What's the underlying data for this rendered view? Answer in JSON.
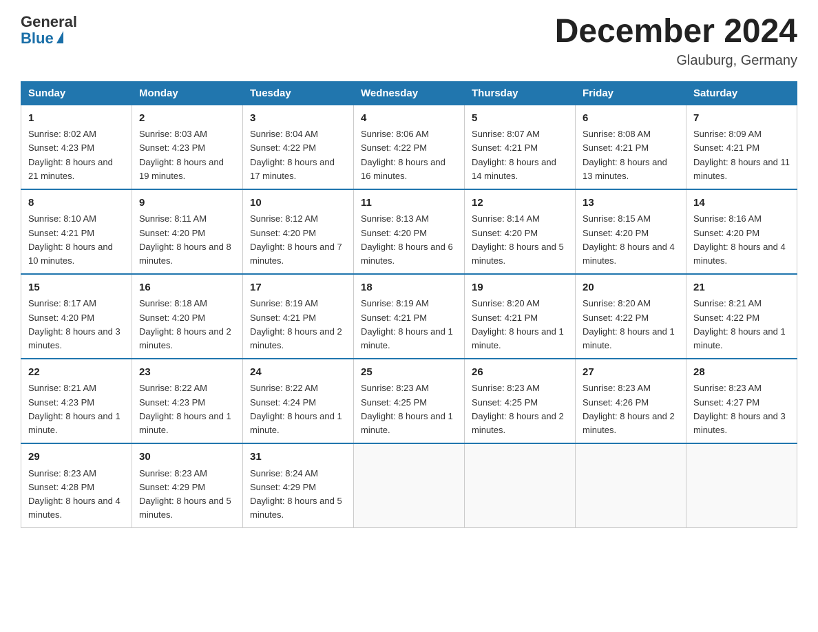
{
  "header": {
    "logo_general": "General",
    "logo_blue": "Blue",
    "month_title": "December 2024",
    "location": "Glauburg, Germany"
  },
  "days_of_week": [
    "Sunday",
    "Monday",
    "Tuesday",
    "Wednesday",
    "Thursday",
    "Friday",
    "Saturday"
  ],
  "weeks": [
    [
      {
        "day": "1",
        "sunrise": "8:02 AM",
        "sunset": "4:23 PM",
        "daylight": "8 hours and 21 minutes."
      },
      {
        "day": "2",
        "sunrise": "8:03 AM",
        "sunset": "4:23 PM",
        "daylight": "8 hours and 19 minutes."
      },
      {
        "day": "3",
        "sunrise": "8:04 AM",
        "sunset": "4:22 PM",
        "daylight": "8 hours and 17 minutes."
      },
      {
        "day": "4",
        "sunrise": "8:06 AM",
        "sunset": "4:22 PM",
        "daylight": "8 hours and 16 minutes."
      },
      {
        "day": "5",
        "sunrise": "8:07 AM",
        "sunset": "4:21 PM",
        "daylight": "8 hours and 14 minutes."
      },
      {
        "day": "6",
        "sunrise": "8:08 AM",
        "sunset": "4:21 PM",
        "daylight": "8 hours and 13 minutes."
      },
      {
        "day": "7",
        "sunrise": "8:09 AM",
        "sunset": "4:21 PM",
        "daylight": "8 hours and 11 minutes."
      }
    ],
    [
      {
        "day": "8",
        "sunrise": "8:10 AM",
        "sunset": "4:21 PM",
        "daylight": "8 hours and 10 minutes."
      },
      {
        "day": "9",
        "sunrise": "8:11 AM",
        "sunset": "4:20 PM",
        "daylight": "8 hours and 8 minutes."
      },
      {
        "day": "10",
        "sunrise": "8:12 AM",
        "sunset": "4:20 PM",
        "daylight": "8 hours and 7 minutes."
      },
      {
        "day": "11",
        "sunrise": "8:13 AM",
        "sunset": "4:20 PM",
        "daylight": "8 hours and 6 minutes."
      },
      {
        "day": "12",
        "sunrise": "8:14 AM",
        "sunset": "4:20 PM",
        "daylight": "8 hours and 5 minutes."
      },
      {
        "day": "13",
        "sunrise": "8:15 AM",
        "sunset": "4:20 PM",
        "daylight": "8 hours and 4 minutes."
      },
      {
        "day": "14",
        "sunrise": "8:16 AM",
        "sunset": "4:20 PM",
        "daylight": "8 hours and 4 minutes."
      }
    ],
    [
      {
        "day": "15",
        "sunrise": "8:17 AM",
        "sunset": "4:20 PM",
        "daylight": "8 hours and 3 minutes."
      },
      {
        "day": "16",
        "sunrise": "8:18 AM",
        "sunset": "4:20 PM",
        "daylight": "8 hours and 2 minutes."
      },
      {
        "day": "17",
        "sunrise": "8:19 AM",
        "sunset": "4:21 PM",
        "daylight": "8 hours and 2 minutes."
      },
      {
        "day": "18",
        "sunrise": "8:19 AM",
        "sunset": "4:21 PM",
        "daylight": "8 hours and 1 minute."
      },
      {
        "day": "19",
        "sunrise": "8:20 AM",
        "sunset": "4:21 PM",
        "daylight": "8 hours and 1 minute."
      },
      {
        "day": "20",
        "sunrise": "8:20 AM",
        "sunset": "4:22 PM",
        "daylight": "8 hours and 1 minute."
      },
      {
        "day": "21",
        "sunrise": "8:21 AM",
        "sunset": "4:22 PM",
        "daylight": "8 hours and 1 minute."
      }
    ],
    [
      {
        "day": "22",
        "sunrise": "8:21 AM",
        "sunset": "4:23 PM",
        "daylight": "8 hours and 1 minute."
      },
      {
        "day": "23",
        "sunrise": "8:22 AM",
        "sunset": "4:23 PM",
        "daylight": "8 hours and 1 minute."
      },
      {
        "day": "24",
        "sunrise": "8:22 AM",
        "sunset": "4:24 PM",
        "daylight": "8 hours and 1 minute."
      },
      {
        "day": "25",
        "sunrise": "8:23 AM",
        "sunset": "4:25 PM",
        "daylight": "8 hours and 1 minute."
      },
      {
        "day": "26",
        "sunrise": "8:23 AM",
        "sunset": "4:25 PM",
        "daylight": "8 hours and 2 minutes."
      },
      {
        "day": "27",
        "sunrise": "8:23 AM",
        "sunset": "4:26 PM",
        "daylight": "8 hours and 2 minutes."
      },
      {
        "day": "28",
        "sunrise": "8:23 AM",
        "sunset": "4:27 PM",
        "daylight": "8 hours and 3 minutes."
      }
    ],
    [
      {
        "day": "29",
        "sunrise": "8:23 AM",
        "sunset": "4:28 PM",
        "daylight": "8 hours and 4 minutes."
      },
      {
        "day": "30",
        "sunrise": "8:23 AM",
        "sunset": "4:29 PM",
        "daylight": "8 hours and 5 minutes."
      },
      {
        "day": "31",
        "sunrise": "8:24 AM",
        "sunset": "4:29 PM",
        "daylight": "8 hours and 5 minutes."
      },
      null,
      null,
      null,
      null
    ]
  ]
}
